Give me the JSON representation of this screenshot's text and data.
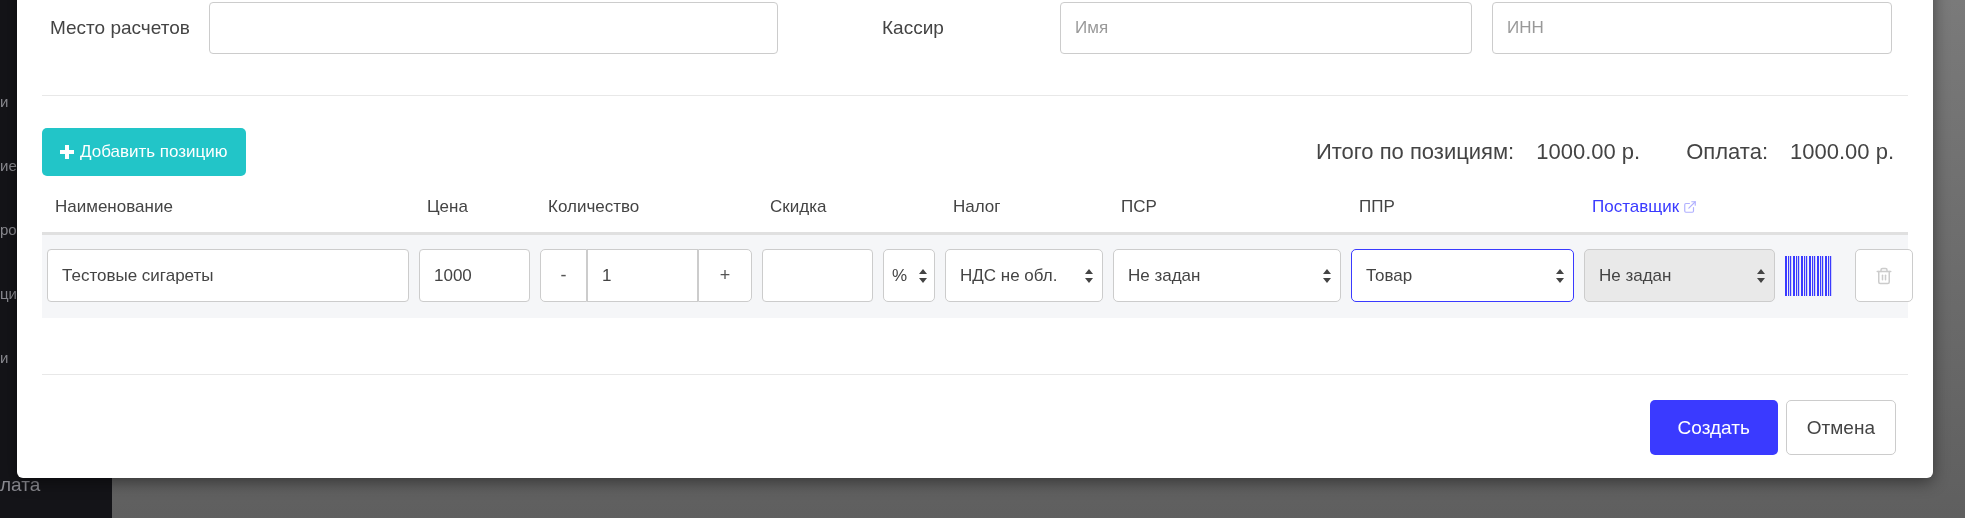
{
  "background": {
    "sidebar_fragments": [
      "и",
      "ие",
      "ро",
      "ци",
      "и"
    ],
    "sidebar_bottom": "лата"
  },
  "place": {
    "label": "Место расчетов"
  },
  "cashier": {
    "label": "Кассир",
    "name_placeholder": "Имя",
    "inn_placeholder": "ИНН"
  },
  "add_button": "Добавить позицию",
  "totals": [
    {
      "label": "Итого по позициям:",
      "value": "1000.00 р."
    },
    {
      "label": "Оплата:",
      "value": "1000.00 р."
    }
  ],
  "columns": [
    {
      "label": "Наименование",
      "kind": "text"
    },
    {
      "label": "Цена",
      "kind": "text"
    },
    {
      "label": "Количество",
      "kind": "text"
    },
    {
      "label": "Скидка",
      "kind": "text"
    },
    {
      "label": "Налог",
      "kind": "text"
    },
    {
      "label": "ПСР",
      "kind": "text"
    },
    {
      "label": "ППР",
      "kind": "text"
    },
    {
      "label": "Поставщик",
      "kind": "link"
    }
  ],
  "rows": [
    {
      "name": "Тестовые сигареты",
      "price": "1000",
      "quantity": "1",
      "minus": "-",
      "plus": "+",
      "discount_unit": "%",
      "selects": [
        {
          "value": "НДС не обл.",
          "focused": false,
          "disabled": false
        },
        {
          "value": "Не задан",
          "focused": false,
          "disabled": false
        },
        {
          "value": "Товар",
          "focused": true,
          "disabled": false
        },
        {
          "value": "Не задан",
          "focused": false,
          "disabled": true
        }
      ]
    }
  ],
  "buttons": [
    {
      "label": "Создать",
      "kind": "primary"
    },
    {
      "label": "Отмена",
      "kind": "secondary"
    }
  ]
}
